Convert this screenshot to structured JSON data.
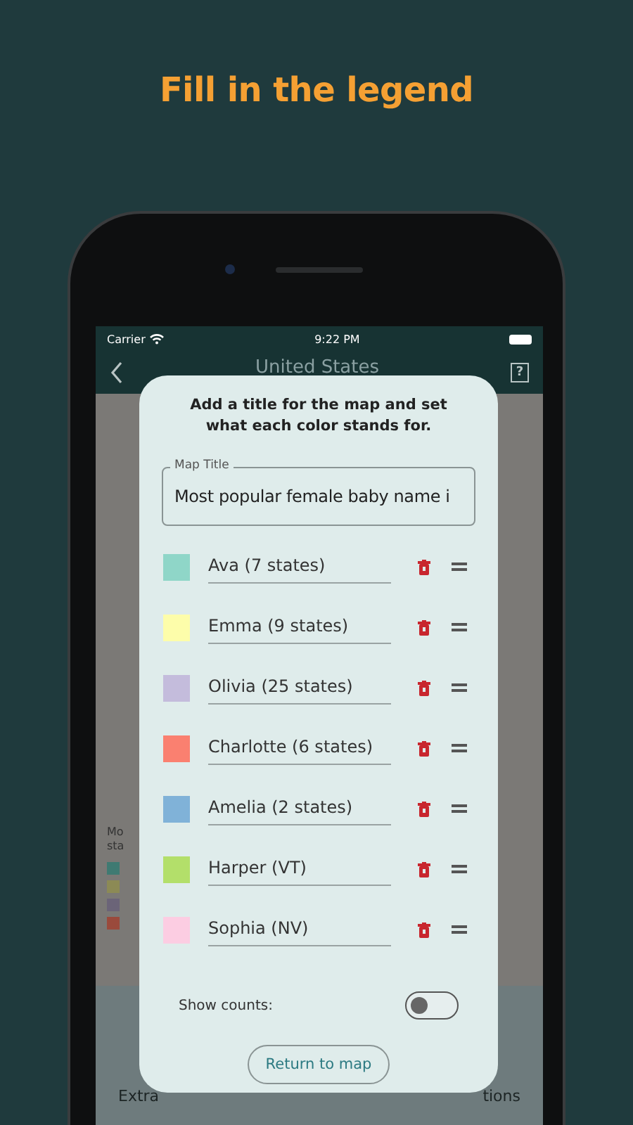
{
  "headline": "Fill in the legend",
  "status_bar": {
    "carrier": "Carrier",
    "time": "9:22 PM"
  },
  "nav": {
    "title": "United States",
    "help": "?"
  },
  "background_legend": {
    "fragments": [
      "Mo",
      "sta"
    ],
    "swatches": [
      {
        "color": "#3f7a72"
      },
      {
        "color": "#8c8a55"
      },
      {
        "color": "#6b6478"
      },
      {
        "color": "#9a4a3c"
      }
    ]
  },
  "tab_bar": {
    "labels": [
      "Extra",
      "tions"
    ]
  },
  "dialog": {
    "prompt": "Add a title for the map and set what each color stands for.",
    "title_field": {
      "label": "Map Title",
      "value": "Most popular female baby name i"
    },
    "legend": [
      {
        "label": "Ava (7 states)",
        "color": "#8fd6c8"
      },
      {
        "label": "Emma (9 states)",
        "color": "#fdfdaa"
      },
      {
        "label": "Olivia (25 states)",
        "color": "#c4bcdc"
      },
      {
        "label": "Charlotte (6 states)",
        "color": "#fa8070"
      },
      {
        "label": "Amelia (2 states)",
        "color": "#80b2d8"
      },
      {
        "label": "Harper (VT)",
        "color": "#b3df6a"
      },
      {
        "label": "Sophia (NV)",
        "color": "#fccde2"
      }
    ],
    "show_counts": {
      "label": "Show counts:",
      "on": false
    },
    "button": "Return to map"
  }
}
